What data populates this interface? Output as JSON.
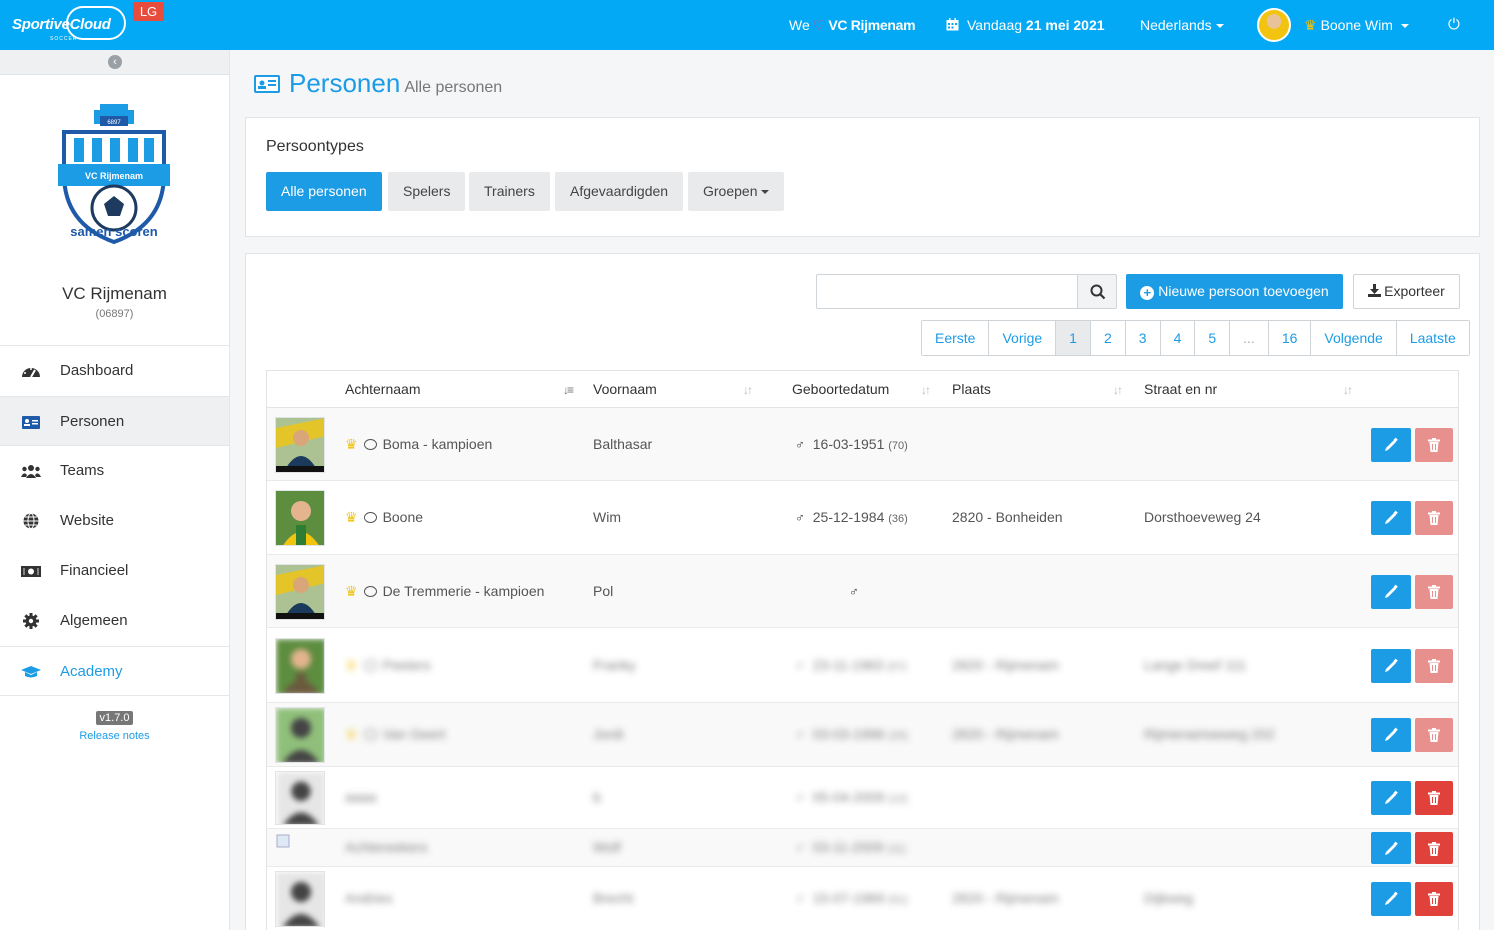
{
  "app": {
    "logo_text": "SportiveCloud",
    "logo_sub": "SOCCER",
    "badge": "LG"
  },
  "topbar": {
    "we": "We",
    "club": "VC Rijmenam",
    "date_prefix": "Vandaag",
    "date": "21 mei 2021",
    "language": "Nederlands",
    "user": "Boone Wim"
  },
  "sidebar": {
    "club_name": "VC Rijmenam",
    "club_number": "(06897)",
    "logo_text_top": "6897",
    "logo_banner": "VC Rijmenam",
    "logo_slogan": "samen scoren",
    "items": [
      {
        "label": "Dashboard",
        "icon": "dashboard-icon"
      },
      {
        "label": "Personen",
        "icon": "id-card-icon"
      },
      {
        "label": "Teams",
        "icon": "users-icon"
      },
      {
        "label": "Website",
        "icon": "globe-icon"
      },
      {
        "label": "Financieel",
        "icon": "money-icon"
      },
      {
        "label": "Algemeen",
        "icon": "gear-icon"
      },
      {
        "label": "Academy",
        "icon": "graduation-cap-icon"
      }
    ],
    "version": "v1.7.0",
    "release_notes": "Release notes"
  },
  "page": {
    "title": "Personen",
    "subtitle": "Alle personen"
  },
  "person_types": {
    "title": "Persoontypes",
    "buttons": [
      "Alle personen",
      "Spelers",
      "Trainers",
      "Afgevaardigden",
      "Groepen"
    ]
  },
  "toolbar": {
    "search_placeholder": "",
    "new_person": "Nieuwe persoon toevoegen",
    "export": "Exporteer"
  },
  "pagination": [
    "Eerste",
    "Vorige",
    "1",
    "2",
    "3",
    "4",
    "5",
    "...",
    "16",
    "Volgende",
    "Laatste"
  ],
  "table": {
    "columns": [
      "Achternaam",
      "Voornaam",
      "Geboortedatum",
      "Plaats",
      "Straat en nr"
    ],
    "rows": [
      {
        "lastname": "Boma - kampioen",
        "firstname": "Balthasar",
        "birthdate": "16-03-1951",
        "age": "(70)",
        "place": "",
        "street": "",
        "crown": true,
        "blurred": false,
        "photo": "player-card"
      },
      {
        "lastname": "Boone",
        "firstname": "Wim",
        "birthdate": "25-12-1984",
        "age": "(36)",
        "place": "2820 - Bonheiden",
        "street": "Dorsthoeveweg 24",
        "crown": true,
        "blurred": false,
        "photo": "portrait"
      },
      {
        "lastname": "De Tremmerie - kampioen",
        "firstname": "Pol",
        "birthdate": "",
        "age": "",
        "place": "",
        "street": "",
        "crown": true,
        "blurred": false,
        "photo": "player-card"
      },
      {
        "lastname": "Peeters",
        "firstname": "Franky",
        "birthdate": "23-11-1963",
        "age": "(57)",
        "place": "2820 - Rijmenam",
        "street": "Lange Dreef 111",
        "crown": true,
        "blurred": true,
        "photo": "portrait"
      },
      {
        "lastname": "Van Geert",
        "firstname": "Jordi",
        "birthdate": "03-03-1996",
        "age": "(25)",
        "place": "2820 - Rijmenam",
        "street": "Rijmenamseweg 202",
        "crown": true,
        "blurred": true,
        "photo": "silhouette-green"
      },
      {
        "lastname": "aaaa",
        "firstname": "b",
        "birthdate": "05-04-2009",
        "age": "(12)",
        "place": "",
        "street": "",
        "crown": false,
        "blurred": true,
        "photo": "silhouette"
      },
      {
        "lastname": "Achtereekers",
        "firstname": "Wolf",
        "birthdate": "03-11-2009",
        "age": "(11)",
        "place": "",
        "street": "",
        "crown": false,
        "blurred": true,
        "photo": "broken"
      },
      {
        "lastname": "Andries",
        "firstname": "Brecht",
        "birthdate": "15-07-1969",
        "age": "(51)",
        "place": "2820 - Rijmenam",
        "street": "Dijkweg",
        "crown": false,
        "blurred": true,
        "photo": "silhouette"
      }
    ]
  },
  "colors": {
    "accent": "#03a9f4",
    "primary_button": "#1d9ce6",
    "danger": "#e0413b",
    "danger_light": "#e8908d",
    "crown": "#f1c40f",
    "badge": "#e74c3c"
  }
}
